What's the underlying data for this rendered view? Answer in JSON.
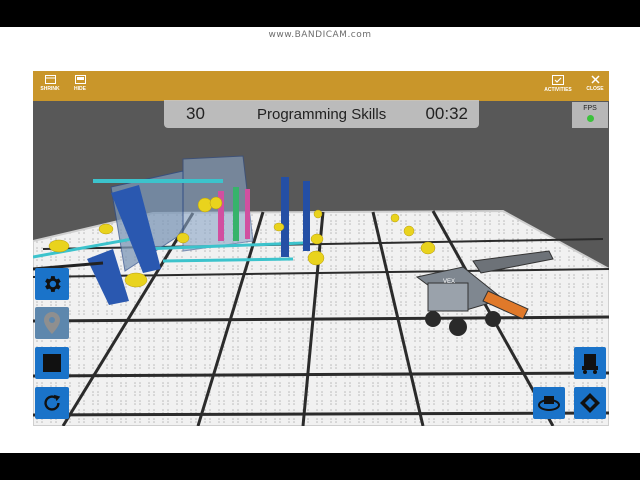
{
  "watermark": "www.BANDICAM.com",
  "toolbar": {
    "shrink_label": "SHRINK",
    "hide_label": "HIDE",
    "activities_label": "ACTIVITIES",
    "close_label": "CLOSE"
  },
  "hud": {
    "score": "30",
    "mode_title": "Programming Skills",
    "timer": "00:32"
  },
  "fps": {
    "label": "FPS",
    "status_color": "#3bc13b"
  },
  "robot": {
    "label": "VEX"
  },
  "left_controls": [
    "gear-icon",
    "map-pin-icon",
    "stop-icon",
    "reset-icon"
  ],
  "right_controls": [
    "robot-view-icon",
    "camera-orbit-icon",
    "camera-angle-icon"
  ],
  "colors": {
    "toolbar": "#c9962a",
    "button": "#1a73c9",
    "button_disabled": "#5d87ad",
    "background": "#585858"
  }
}
